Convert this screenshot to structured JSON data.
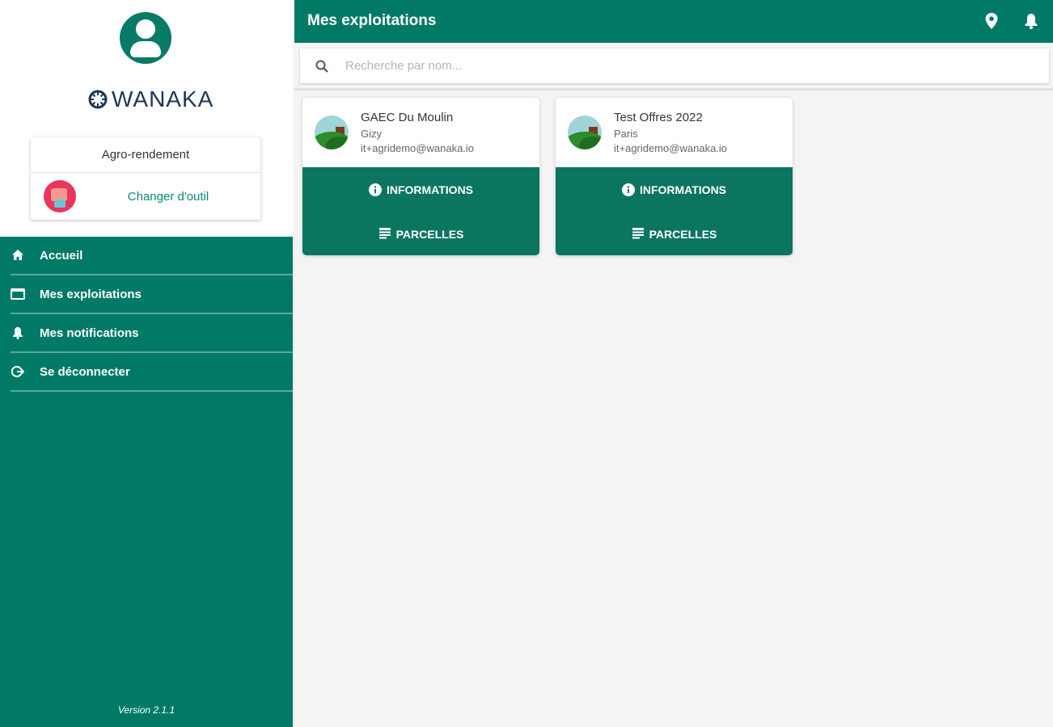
{
  "sidebar": {
    "brand": "WANAKA",
    "tool_card": {
      "title": "Agro-rendement",
      "change_label": "Changer d'outil"
    },
    "nav": [
      {
        "label": "Accueil",
        "icon": "home-icon"
      },
      {
        "label": "Mes exploitations",
        "icon": "window-icon"
      },
      {
        "label": "Mes notifications",
        "icon": "bell-icon"
      },
      {
        "label": "Se déconnecter",
        "icon": "logout-icon"
      }
    ],
    "version": "Version 2.1.1"
  },
  "header": {
    "title": "Mes exploitations",
    "icons": [
      "location-pin-icon",
      "bell-icon"
    ]
  },
  "search": {
    "placeholder": "Recherche par nom...",
    "value": ""
  },
  "farms": [
    {
      "name": "GAEC Du Moulin",
      "city": "Gizy",
      "email": "it+agridemo@wanaka.io",
      "info_label": "INFORMATIONS",
      "parcels_label": "PARCELLES"
    },
    {
      "name": "Test Offres 2022",
      "city": "Paris",
      "email": "it+agridemo@wanaka.io",
      "info_label": "INFORMATIONS",
      "parcels_label": "PARCELLES"
    }
  ],
  "colors": {
    "primary": "#007a66",
    "card_button": "#0b7560",
    "background": "#f4f4f4",
    "brand_text": "#1d3557"
  }
}
